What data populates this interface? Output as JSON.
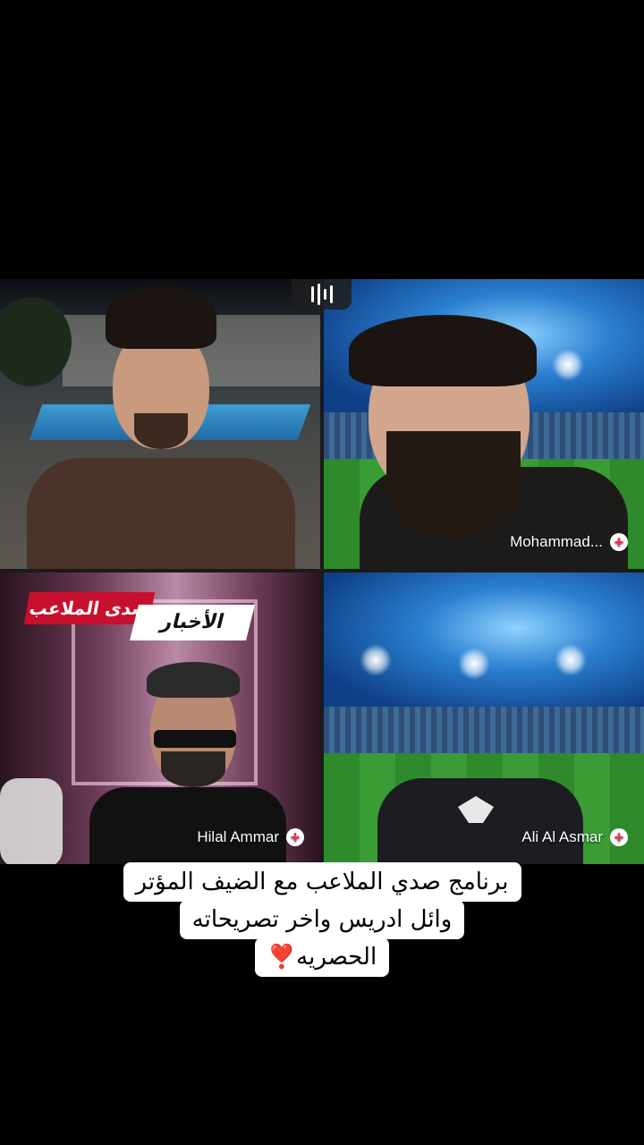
{
  "participants": [
    {
      "name": ""
    },
    {
      "name": "Mohammad..."
    },
    {
      "name": "Hilal Ammar"
    },
    {
      "name": "Ali Al Asmar"
    }
  ],
  "plus_glyph": "+",
  "news_badge": {
    "red_text": "صدى الملاعب",
    "white_text": "الأخبار"
  },
  "caption": {
    "lines": [
      "برنامج صدي الملاعب مع الضيف المؤتر",
      "وائل ادريس واخر تصريحاته",
      "الحصريه❣️"
    ]
  },
  "colors": {
    "accent": "#fe2c55",
    "badge_red": "#c8102e"
  }
}
